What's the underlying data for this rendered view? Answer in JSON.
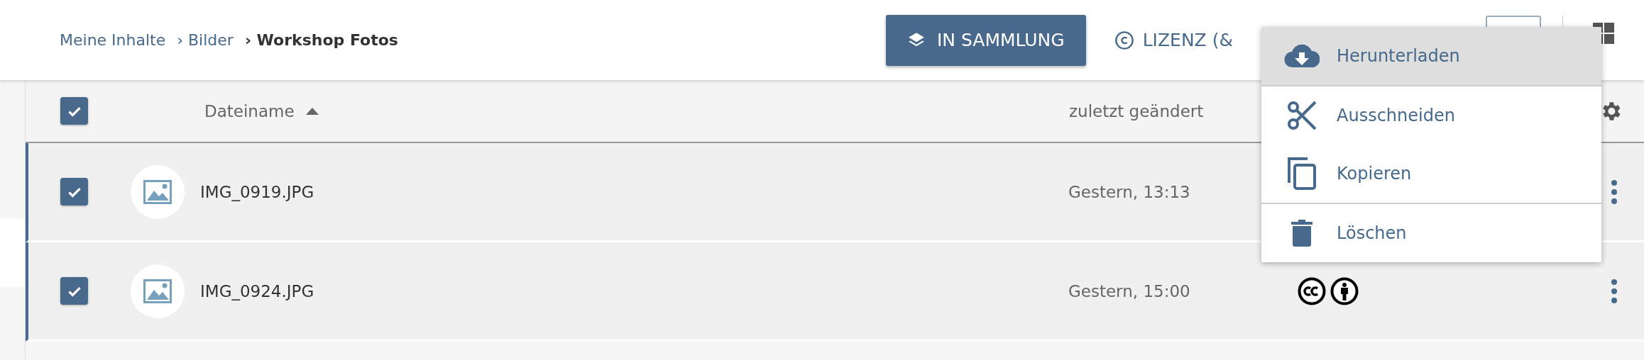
{
  "breadcrumb": [
    {
      "label": "Meine Inhalte",
      "current": false
    },
    {
      "label": "› Bilder",
      "current": false
    },
    {
      "label": "› Workshop Fotos",
      "current": true
    }
  ],
  "toolbar": {
    "collection_button": "IN SAMMLUNG",
    "license_button": "LIZENZ (&"
  },
  "table": {
    "all_checked": true,
    "columns": [
      {
        "label": "Dateiname",
        "sorted": true
      },
      {
        "label": "zuletzt geändert",
        "sorted": false
      }
    ],
    "rows": [
      {
        "name": "IMG_0919.JPG",
        "modified": "Gestern, 13:13",
        "checked": true
      },
      {
        "name": "IMG_0924.JPG",
        "modified": "Gestern, 15:00",
        "checked": true,
        "license_icons": [
          {
            "kind": "cc"
          },
          {
            "kind": "by"
          }
        ]
      }
    ]
  },
  "context_menu": [
    {
      "label": "Herunterladen",
      "kind": "download",
      "selected": true
    },
    {
      "label": "Ausschneiden",
      "kind": "cut",
      "selected": false
    },
    {
      "label": "Kopieren",
      "kind": "copy",
      "selected": false
    },
    {
      "label": "Löschen",
      "kind": "delete",
      "selected": false
    }
  ]
}
